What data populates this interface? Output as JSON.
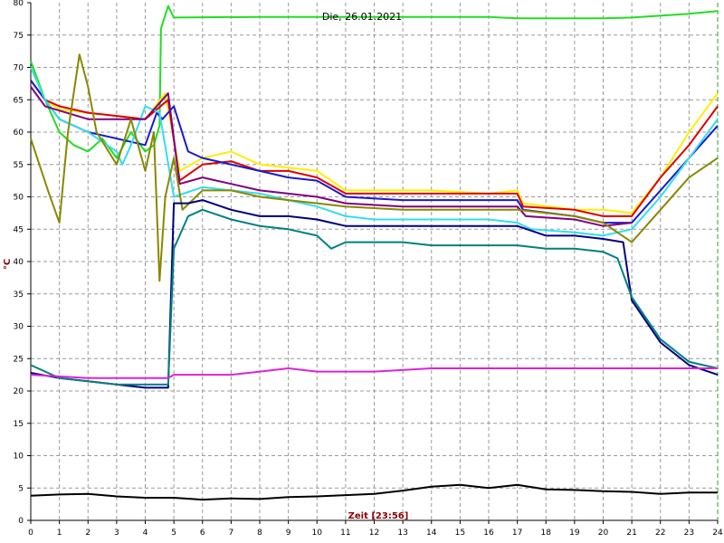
{
  "chart_data": {
    "type": "line",
    "title": "Die, 26.01.2021",
    "xlabel": "Zeit [23:56]",
    "ylabel": "°C",
    "xlim": [
      0,
      24
    ],
    "ylim": [
      0,
      80
    ],
    "x_ticks": [
      "0",
      "1",
      "2",
      "3",
      "4",
      "5",
      "6",
      "7",
      "8",
      "9",
      "10",
      "11",
      "12",
      "13",
      "14",
      "15",
      "16",
      "17",
      "18",
      "19",
      "20",
      "21",
      "22",
      "23",
      "24"
    ],
    "y_ticks": [
      "0",
      "5",
      "10",
      "15",
      "20",
      "25",
      "30",
      "35",
      "40",
      "45",
      "50",
      "55",
      "60",
      "65",
      "70",
      "75",
      "80"
    ],
    "grid": true,
    "series": [
      {
        "color": "#22dd22",
        "points": [
          [
            0,
            71
          ],
          [
            0.5,
            65
          ],
          [
            1,
            60
          ],
          [
            1.5,
            58
          ],
          [
            2,
            57
          ],
          [
            2.5,
            59
          ],
          [
            3,
            56
          ],
          [
            3.5,
            60
          ],
          [
            4,
            57
          ],
          [
            4.3,
            58
          ],
          [
            4.5,
            61
          ],
          [
            4.55,
            76
          ],
          [
            4.8,
            79.5
          ],
          [
            5,
            77.7
          ],
          [
            8,
            77.8
          ],
          [
            12,
            77.8
          ],
          [
            16,
            77.8
          ],
          [
            17,
            77.6
          ],
          [
            20,
            77.6
          ],
          [
            21,
            77.7
          ],
          [
            23,
            78.3
          ],
          [
            24,
            78.7
          ]
        ]
      },
      {
        "color": "#ffee00",
        "points": [
          [
            0,
            70
          ],
          [
            0.5,
            65
          ],
          [
            1,
            63.5
          ],
          [
            2,
            63
          ],
          [
            3,
            62.5
          ],
          [
            4,
            62
          ],
          [
            4.7,
            66
          ],
          [
            5.2,
            54
          ],
          [
            6,
            56
          ],
          [
            7,
            57
          ],
          [
            8,
            55
          ],
          [
            9,
            54.5
          ],
          [
            10,
            54
          ],
          [
            11,
            51
          ],
          [
            12,
            51
          ],
          [
            14,
            51
          ],
          [
            16,
            50.5
          ],
          [
            17,
            51
          ],
          [
            17.2,
            49
          ],
          [
            19,
            48
          ],
          [
            20,
            48
          ],
          [
            21,
            47.5
          ],
          [
            22,
            53
          ],
          [
            23,
            60
          ],
          [
            24,
            66
          ]
        ]
      },
      {
        "color": "#dd0000",
        "points": [
          [
            0,
            68
          ],
          [
            0.5,
            65
          ],
          [
            1,
            64
          ],
          [
            2,
            63
          ],
          [
            3,
            62.5
          ],
          [
            4,
            62
          ],
          [
            4.8,
            65
          ],
          [
            5.2,
            52.5
          ],
          [
            6,
            55
          ],
          [
            7,
            55.5
          ],
          [
            8,
            54
          ],
          [
            9,
            54
          ],
          [
            10,
            53
          ],
          [
            11,
            50.5
          ],
          [
            13,
            50.5
          ],
          [
            16,
            50.5
          ],
          [
            17,
            50.5
          ],
          [
            17.2,
            48.5
          ],
          [
            19,
            48
          ],
          [
            20,
            47
          ],
          [
            21,
            47
          ],
          [
            22,
            53
          ],
          [
            23,
            58
          ],
          [
            24,
            64
          ]
        ]
      },
      {
        "color": "#1a1acc",
        "points": [
          [
            0,
            68
          ],
          [
            0.5,
            65
          ],
          [
            1,
            62
          ],
          [
            2,
            60
          ],
          [
            3,
            59
          ],
          [
            4,
            58
          ],
          [
            4.4,
            63
          ],
          [
            4.6,
            62
          ],
          [
            5,
            64
          ],
          [
            5.5,
            57
          ],
          [
            6,
            56
          ],
          [
            7,
            55
          ],
          [
            8,
            54
          ],
          [
            9,
            53
          ],
          [
            10,
            52.5
          ],
          [
            11,
            50
          ],
          [
            13,
            49.5
          ],
          [
            16,
            49.5
          ],
          [
            17,
            49.5
          ],
          [
            17.2,
            48
          ],
          [
            19,
            47
          ],
          [
            20,
            46
          ],
          [
            21,
            46
          ],
          [
            22,
            51
          ],
          [
            23,
            56
          ],
          [
            24,
            61
          ]
        ]
      },
      {
        "color": "#33ddee",
        "points": [
          [
            0,
            70
          ],
          [
            0.5,
            65
          ],
          [
            1,
            62
          ],
          [
            2,
            60
          ],
          [
            3,
            57
          ],
          [
            3.2,
            55
          ],
          [
            3.5,
            58
          ],
          [
            4,
            64
          ],
          [
            4.5,
            63
          ],
          [
            5,
            50
          ],
          [
            6,
            51.5
          ],
          [
            7,
            51
          ],
          [
            8,
            50.5
          ],
          [
            9,
            49.5
          ],
          [
            10,
            48.5
          ],
          [
            11,
            47
          ],
          [
            12,
            46.5
          ],
          [
            14,
            46.5
          ],
          [
            16,
            46.5
          ],
          [
            17,
            46
          ],
          [
            17.5,
            45
          ],
          [
            19,
            44.5
          ],
          [
            20,
            44
          ],
          [
            21,
            45
          ],
          [
            22,
            50
          ],
          [
            23,
            56
          ],
          [
            24,
            62
          ]
        ]
      },
      {
        "color": "#800080",
        "points": [
          [
            0,
            67
          ],
          [
            0.5,
            64
          ],
          [
            2,
            62
          ],
          [
            4,
            62
          ],
          [
            4.8,
            66
          ],
          [
            5.2,
            52
          ],
          [
            6,
            53
          ],
          [
            7,
            52
          ],
          [
            8,
            51
          ],
          [
            9,
            50.5
          ],
          [
            10,
            50
          ],
          [
            11,
            49
          ],
          [
            13,
            48.5
          ],
          [
            16,
            48.5
          ],
          [
            17,
            48.5
          ],
          [
            17.3,
            47
          ],
          [
            19,
            46.5
          ],
          [
            20,
            45.5
          ],
          [
            21,
            46
          ]
        ]
      },
      {
        "color": "#888800",
        "points": [
          [
            0,
            59
          ],
          [
            0.3,
            55
          ],
          [
            0.6,
            51
          ],
          [
            1,
            46
          ],
          [
            1.3,
            60
          ],
          [
            1.7,
            72
          ],
          [
            2,
            67
          ],
          [
            2.3,
            60
          ],
          [
            3,
            55
          ],
          [
            3.5,
            62
          ],
          [
            4,
            54
          ],
          [
            4.3,
            60
          ],
          [
            4.5,
            37
          ],
          [
            4.7,
            50
          ],
          [
            5,
            56
          ],
          [
            5.3,
            48
          ],
          [
            6,
            51
          ],
          [
            7,
            51
          ],
          [
            8,
            50
          ],
          [
            9,
            49.5
          ],
          [
            10,
            49
          ],
          [
            11,
            48.5
          ],
          [
            13,
            48
          ],
          [
            16,
            48
          ],
          [
            17,
            48
          ],
          [
            19,
            47
          ],
          [
            20,
            46
          ],
          [
            21,
            43
          ],
          [
            22,
            48
          ],
          [
            23,
            53
          ],
          [
            24,
            56
          ]
        ]
      },
      {
        "color": "#000080",
        "points": [
          [
            0,
            22.8
          ],
          [
            1,
            22
          ],
          [
            2,
            21.5
          ],
          [
            3,
            21
          ],
          [
            4,
            20.5
          ],
          [
            4.8,
            20.5
          ],
          [
            5,
            49
          ],
          [
            5.5,
            49
          ],
          [
            6,
            49.5
          ],
          [
            7,
            48
          ],
          [
            8,
            47
          ],
          [
            9,
            47
          ],
          [
            10,
            46.5
          ],
          [
            10.5,
            46
          ],
          [
            11,
            45.5
          ],
          [
            12,
            45.5
          ],
          [
            14,
            45.5
          ],
          [
            16,
            45.5
          ],
          [
            17,
            45.5
          ],
          [
            18,
            44
          ],
          [
            19,
            44
          ],
          [
            20,
            43.5
          ],
          [
            20.7,
            43
          ],
          [
            21,
            34
          ],
          [
            22,
            27.5
          ],
          [
            23,
            24
          ],
          [
            24,
            22.5
          ]
        ]
      },
      {
        "color": "#008080",
        "points": [
          [
            0,
            24
          ],
          [
            1,
            22
          ],
          [
            2,
            21.5
          ],
          [
            3,
            21
          ],
          [
            4,
            21
          ],
          [
            4.8,
            21
          ],
          [
            5,
            42
          ],
          [
            5.5,
            47
          ],
          [
            6,
            48
          ],
          [
            7,
            46.5
          ],
          [
            8,
            45.5
          ],
          [
            9,
            45
          ],
          [
            10,
            44
          ],
          [
            10.5,
            42
          ],
          [
            11,
            43
          ],
          [
            12,
            43
          ],
          [
            13,
            43
          ],
          [
            14,
            42.5
          ],
          [
            15,
            42.5
          ],
          [
            16,
            42.5
          ],
          [
            17,
            42.5
          ],
          [
            18,
            42
          ],
          [
            19,
            42
          ],
          [
            20,
            41.5
          ],
          [
            20.5,
            40.5
          ],
          [
            21,
            34.5
          ],
          [
            22,
            28
          ],
          [
            23,
            24.5
          ],
          [
            24,
            23.5
          ]
        ]
      },
      {
        "color": "#dd22dd",
        "points": [
          [
            0,
            22.5
          ],
          [
            2,
            22
          ],
          [
            3,
            22
          ],
          [
            4,
            22
          ],
          [
            4.8,
            22
          ],
          [
            5,
            22.5
          ],
          [
            6,
            22.5
          ],
          [
            7,
            22.5
          ],
          [
            8,
            23
          ],
          [
            9,
            23.5
          ],
          [
            10,
            23
          ],
          [
            12,
            23
          ],
          [
            14,
            23.5
          ],
          [
            16,
            23.5
          ],
          [
            18,
            23.5
          ],
          [
            20,
            23.5
          ],
          [
            22,
            23.5
          ],
          [
            24,
            23.5
          ]
        ]
      },
      {
        "color": "#000000",
        "points": [
          [
            0,
            3.8
          ],
          [
            1,
            4
          ],
          [
            2,
            4.1
          ],
          [
            3,
            3.7
          ],
          [
            4,
            3.5
          ],
          [
            5,
            3.5
          ],
          [
            6,
            3.2
          ],
          [
            7,
            3.4
          ],
          [
            8,
            3.3
          ],
          [
            9,
            3.6
          ],
          [
            10,
            3.7
          ],
          [
            11,
            3.9
          ],
          [
            12,
            4.1
          ],
          [
            13,
            4.6
          ],
          [
            14,
            5.2
          ],
          [
            15,
            5.5
          ],
          [
            16,
            5
          ],
          [
            17,
            5.5
          ],
          [
            18,
            4.8
          ],
          [
            19,
            4.7
          ],
          [
            20,
            4.5
          ],
          [
            21,
            4.4
          ],
          [
            22,
            4.1
          ],
          [
            23,
            4.3
          ],
          [
            24,
            4.3
          ]
        ]
      }
    ]
  }
}
